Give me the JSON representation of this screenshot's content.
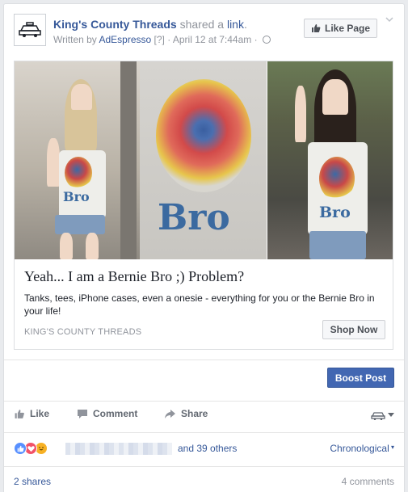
{
  "post": {
    "page_name": "King's County Threads",
    "shared_text": "shared a",
    "link_word": "link",
    "written_by": "Written by",
    "writer": "AdEspresso",
    "help_marker": "[?]",
    "date": "April 12 at 7:44am",
    "like_page_label": "Like Page"
  },
  "preview": {
    "image_text_left": "Bro",
    "image_text_center": "Bro",
    "image_text_right": "Bro",
    "title": "Yeah... I am a Bernie Bro ;) Problem?",
    "description": "Tanks, tees, iPhone cases, even a onesie - everything for you or the Bernie Bro in your life!",
    "domain": "KING'S COUNTY THREADS",
    "cta_label": "Shop Now"
  },
  "boost_label": "Boost Post",
  "actions": {
    "like": "Like",
    "comment": "Comment",
    "share": "Share"
  },
  "reactions": {
    "others_text": "and 39 others",
    "sort_label": "Chronological"
  },
  "footer": {
    "shares": "2 shares",
    "comments": "4 comments"
  },
  "colors": {
    "link_blue": "#365899",
    "boost_blue": "#4267b2",
    "like_reaction": "#5890ff",
    "love_reaction": "#f25268",
    "haha_reaction": "#f7b125"
  }
}
